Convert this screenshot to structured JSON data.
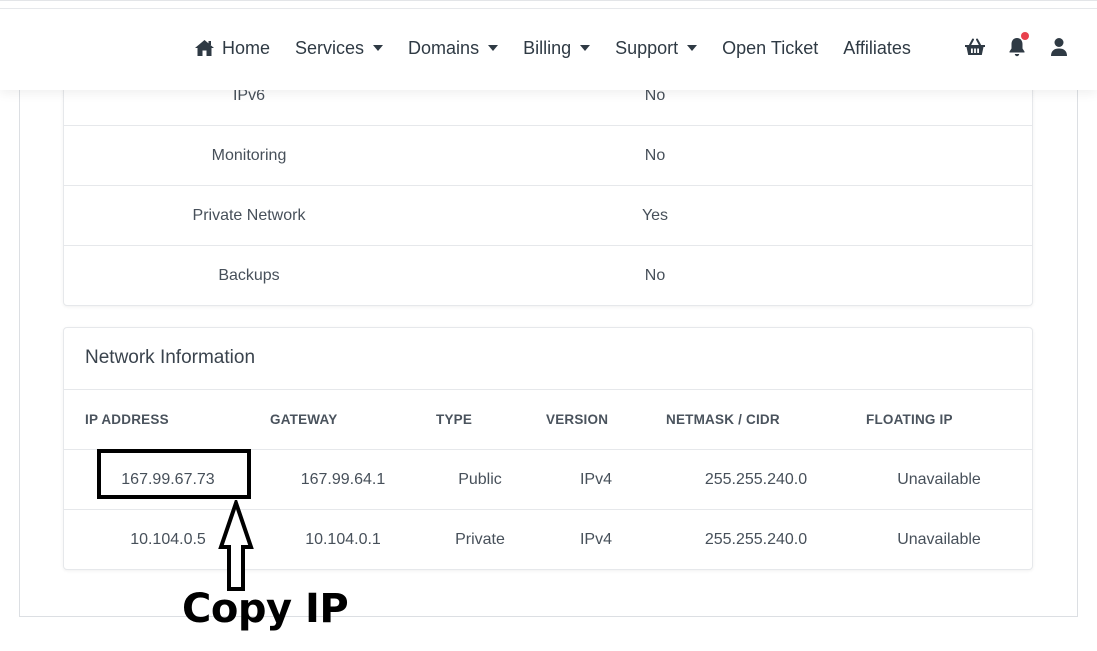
{
  "nav": {
    "items": [
      {
        "label": "Home",
        "icon": "home-icon",
        "has_caret": false
      },
      {
        "label": "Services",
        "has_caret": true
      },
      {
        "label": "Domains",
        "has_caret": true
      },
      {
        "label": "Billing",
        "has_caret": true
      },
      {
        "label": "Support",
        "has_caret": true
      },
      {
        "label": "Open Ticket",
        "has_caret": false
      },
      {
        "label": "Affiliates",
        "has_caret": false
      }
    ],
    "icons": [
      "basket-icon",
      "bell-icon",
      "user-icon"
    ],
    "notification_dot_color": "#e8414d"
  },
  "details": {
    "rows": [
      {
        "label": "IPv6",
        "value": "No"
      },
      {
        "label": "Monitoring",
        "value": "No"
      },
      {
        "label": "Private Network",
        "value": "Yes"
      },
      {
        "label": "Backups",
        "value": "No"
      }
    ]
  },
  "network": {
    "title": "Network Information",
    "headers": [
      "IP ADDRESS",
      "GATEWAY",
      "TYPE",
      "VERSION",
      "NETMASK / CIDR",
      "FLOATING IP"
    ],
    "rows": [
      [
        "167.99.67.73",
        "167.99.64.1",
        "Public",
        "IPv4",
        "255.255.240.0",
        "Unavailable"
      ],
      [
        "10.104.0.5",
        "10.104.0.1",
        "Private",
        "IPv4",
        "255.255.240.0",
        "Unavailable"
      ]
    ]
  },
  "annotation": {
    "label": "Copy IP"
  }
}
